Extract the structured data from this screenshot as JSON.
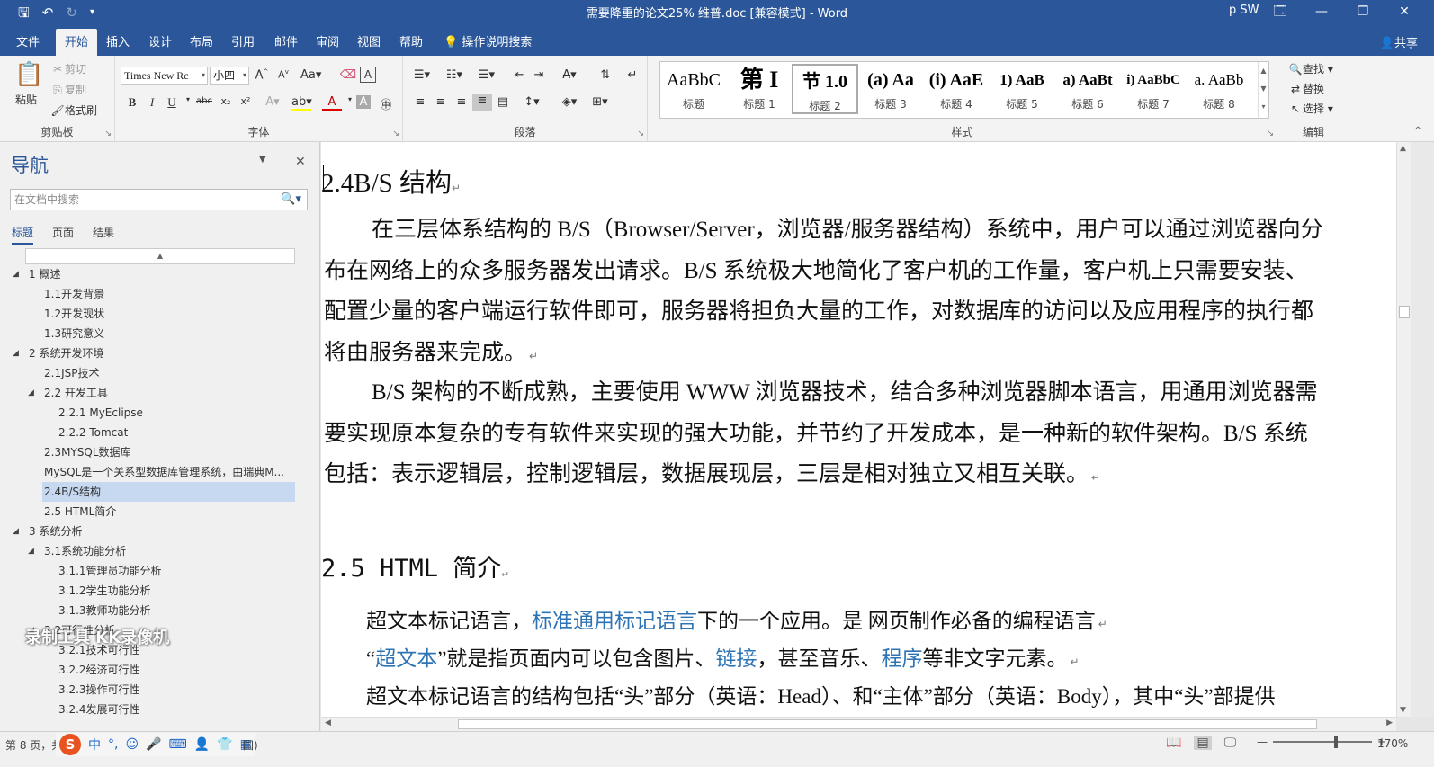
{
  "titlebar": {
    "document_title": "需要降重的论文25% 维普.doc [兼容模式] - Word",
    "user": "p SW",
    "window_buttons": [
      "🗔",
      "—",
      "❐",
      "✕"
    ]
  },
  "tabs": [
    "文件",
    "开始",
    "插入",
    "设计",
    "布局",
    "引用",
    "邮件",
    "审阅",
    "视图",
    "帮助",
    "操作说明搜索"
  ],
  "share_label": "共享",
  "ribbon": {
    "clipboard": {
      "paste": "粘贴",
      "cut": "剪切",
      "copy": "复制",
      "format_painter": "格式刷",
      "label": "剪贴板"
    },
    "font": {
      "font_name": "Times New Rc",
      "font_size": "小四",
      "label": "字体"
    },
    "paragraph": {
      "label": "段落"
    },
    "styles": {
      "label": "样式",
      "tiles": [
        {
          "sample": "AaBbC",
          "name": "标题"
        },
        {
          "sample": "第 I",
          "name": "标题 1"
        },
        {
          "sample": "节 1.0",
          "name": "标题 2"
        },
        {
          "sample": "(a) Aa",
          "name": "标题 3"
        },
        {
          "sample": "(i) AaE",
          "name": "标题 4"
        },
        {
          "sample": "1) AaB",
          "name": "标题 5"
        },
        {
          "sample": "a) AaBt",
          "name": "标题 6"
        },
        {
          "sample": "i) AaBbC",
          "name": "标题 7"
        },
        {
          "sample": "a. AaBb",
          "name": "标题 8"
        }
      ]
    },
    "editing": {
      "find": "查找",
      "replace": "替换",
      "select": "选择",
      "label": "编辑"
    }
  },
  "nav": {
    "title": "导航",
    "search_placeholder": "在文档中搜索",
    "tabs": [
      "标题",
      "页面",
      "结果"
    ],
    "tree": [
      {
        "label": "1 概述",
        "level": 0,
        "caret": true
      },
      {
        "label": "1.1开发背景",
        "level": 1
      },
      {
        "label": "1.2开发现状",
        "level": 1
      },
      {
        "label": "1.3研究意义",
        "level": 1
      },
      {
        "label": "2 系统开发环境",
        "level": 0,
        "caret": true
      },
      {
        "label": "2.1JSP技术",
        "level": 1
      },
      {
        "label": "2.2 开发工具",
        "level": 1,
        "caret": true
      },
      {
        "label": "2.2.1 MyEclipse",
        "level": 2
      },
      {
        "label": "2.2.2 Tomcat",
        "level": 2
      },
      {
        "label": "2.3MYSQL数据库",
        "level": 1
      },
      {
        "label": "MySQL是一个关系型数据库管理系统，由瑞典M...",
        "level": 1
      },
      {
        "label": "2.4B/S结构",
        "level": 1,
        "selected": true
      },
      {
        "label": "2.5 HTML简介",
        "level": 1
      },
      {
        "label": "3 系统分析",
        "level": 0,
        "caret": true
      },
      {
        "label": "3.1系统功能分析",
        "level": 1,
        "caret": true
      },
      {
        "label": "3.1.1管理员功能分析",
        "level": 2
      },
      {
        "label": "3.1.2学生功能分析",
        "level": 2
      },
      {
        "label": "3.1.3教师功能分析",
        "level": 2
      },
      {
        "label": "3.2可行性分析",
        "level": 1,
        "caret": true
      },
      {
        "label": "3.2.1技术可行性",
        "level": 2
      },
      {
        "label": "3.2.2经济可行性",
        "level": 2
      },
      {
        "label": "3.2.3操作可行性",
        "level": 2
      },
      {
        "label": "3.2.4发展可行性",
        "level": 2
      }
    ],
    "watermark": "录制工具 KK录像机"
  },
  "document": {
    "heading1": "2.4B/S 结构",
    "para1": "在三层体系结构的 B/S（Browser/Server，浏览器/服务器结构）系统中，用户可以通过浏览器向分布在网络上的众多服务器发出请求。B/S 系统极大地简化了客户机的工作量，客户机上只需要安装、配置少量的客户端运行软件即可，服务器将担负大量的工作，对数据库的访问以及应用程序的执行都将由服务器来完成。",
    "para2": "B/S 架构的不断成熟，主要使用 WWW 浏览器技术，结合多种浏览器脚本语言，用通用浏览器需要实现原本复杂的专有软件来实现的强大功能，并节约了开发成本，是一种新的软件架构。B/S 系统包括：表示逻辑层，控制逻辑层，数据展现层，三层是相对独立又相互关联。",
    "heading2": "2.5 HTML 简介",
    "line1": {
      "a": "超文本标记语言，",
      "link": "标准通用标记语言",
      "b": "下的一个应用。是 网页制作必备的编程语言"
    },
    "line2": {
      "a": "“",
      "link1": "超文本",
      "b": "”就是指页面内可以包含图片、",
      "link2": "链接",
      "c": "，甚至音乐、",
      "link3": "程序",
      "d": "等非文字元素。"
    },
    "line3": "超文本标记语言的结构包括“头”部分（英语：Head）、和“主体”部分（英语：Body），其中“头”部提供"
  },
  "status": {
    "page_info": "第 8 页，共",
    "ime": [
      "中",
      "°,",
      "☺",
      "🎤",
      "⌨",
      "👤",
      "👕",
      "▦"
    ],
    "lang_info": "国)",
    "zoom": "170%"
  },
  "colors": {
    "accent": "#2b579a",
    "link": "#2e74b5",
    "nav_selected": "#c6d9f1"
  }
}
